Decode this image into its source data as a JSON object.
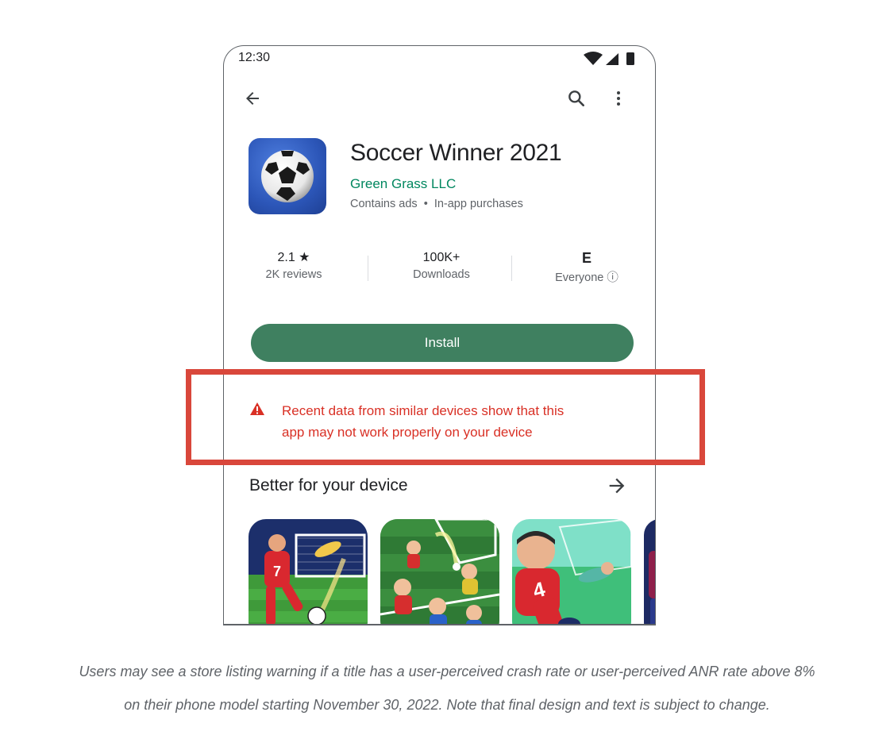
{
  "status_bar": {
    "time": "12:30",
    "icons": [
      "wifi-icon",
      "signal-icon",
      "battery-icon"
    ]
  },
  "toolbar": {
    "back": "arrow-back-icon",
    "search": "search-icon",
    "more": "more-vert-icon"
  },
  "app": {
    "title": "Soccer Winner 2021",
    "developer": "Green Grass LLC",
    "meta": "Contains ads  •  In-app purchases"
  },
  "stats": [
    {
      "value": "2.1 ★",
      "label": "2K reviews"
    },
    {
      "value": "100K+",
      "label": "Downloads"
    },
    {
      "value": "E",
      "label": "Everyone ⓘ"
    }
  ],
  "install_label": "Install",
  "warning": {
    "line1": "Recent data from similar devices show that this",
    "line2": "app may not work properly on your device"
  },
  "section": {
    "title": "Better for your device"
  },
  "cards": [
    {
      "name": "soccer-game-card-1",
      "jersey": "7"
    },
    {
      "name": "soccer-game-card-2",
      "jersey": ""
    },
    {
      "name": "soccer-game-card-3",
      "jersey": "4"
    }
  ],
  "caption": {
    "line1": "Users may see a store listing warning if a title has a user-perceived crash rate or user-perceived ANR rate above 8%",
    "line2": "on their phone model starting November 30, 2022. Note that final design and text is subject to change."
  },
  "colors": {
    "accent_green": "#01875f",
    "install_green": "#3f8060",
    "warning_red": "#d93025",
    "highlight_red": "#d9473b"
  }
}
